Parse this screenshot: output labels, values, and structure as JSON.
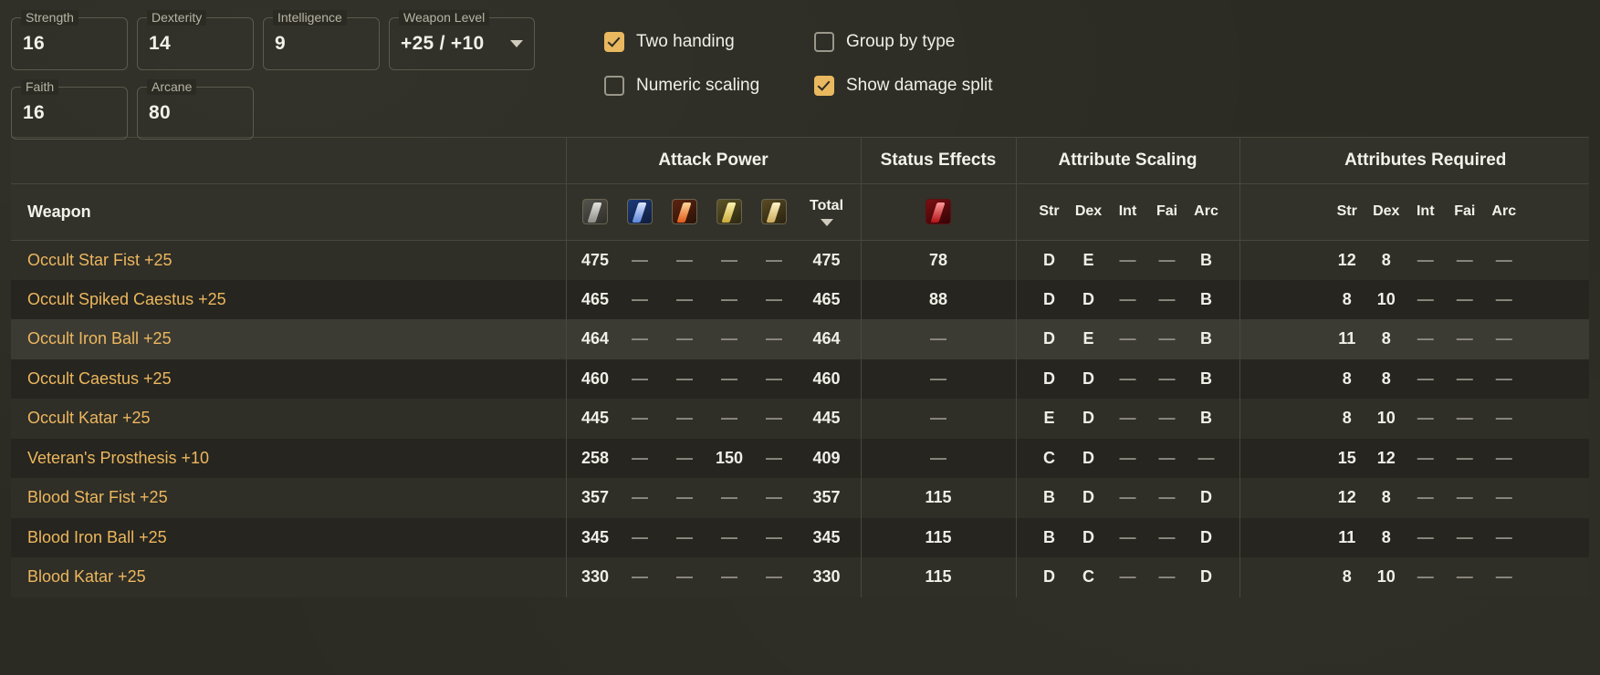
{
  "stats": {
    "fields": [
      {
        "label": "Strength",
        "value": "16",
        "type": "number"
      },
      {
        "label": "Dexterity",
        "value": "14",
        "type": "number"
      },
      {
        "label": "Intelligence",
        "value": "9",
        "type": "number"
      },
      {
        "label": "Weapon Level",
        "value": "+25 / +10",
        "type": "select"
      },
      {
        "label": "Faith",
        "value": "16",
        "type": "number"
      },
      {
        "label": "Arcane",
        "value": "80",
        "type": "number"
      }
    ]
  },
  "options": [
    {
      "label": "Two handing",
      "checked": true
    },
    {
      "label": "Group by type",
      "checked": false
    },
    {
      "label": "Numeric scaling",
      "checked": false
    },
    {
      "label": "Show damage split",
      "checked": true
    }
  ],
  "table": {
    "groups": [
      {
        "label": "",
        "name": "weapon"
      },
      {
        "label": "Attack Power",
        "name": "attack-power"
      },
      {
        "label": "Status Effects",
        "name": "status-effects"
      },
      {
        "label": "Attribute Scaling",
        "name": "attribute-scaling"
      },
      {
        "label": "Attributes Required",
        "name": "attributes-required"
      }
    ],
    "name_header": "Weapon",
    "total_header": "Total",
    "sort": {
      "column": "Total",
      "direction": "desc",
      "glyph": "▼"
    },
    "damage_icons": [
      {
        "name": "physical-damage-icon",
        "cls": "ico-phys"
      },
      {
        "name": "magic-damage-icon",
        "cls": "ico-mag"
      },
      {
        "name": "fire-damage-icon",
        "cls": "ico-fire"
      },
      {
        "name": "lightning-damage-icon",
        "cls": "ico-lit"
      },
      {
        "name": "holy-damage-icon",
        "cls": "ico-holy"
      }
    ],
    "status_icon": {
      "name": "bleed-status-icon",
      "cls": "ico-bleed"
    },
    "attribute_headers": [
      "Str",
      "Dex",
      "Int",
      "Fai",
      "Arc"
    ],
    "rows": [
      {
        "name": "Occult Star Fist +25",
        "damage": [
          "475",
          "—",
          "—",
          "—",
          "—"
        ],
        "total": "475",
        "status": [
          "78"
        ],
        "scaling": [
          "D",
          "E",
          "—",
          "—",
          "B"
        ],
        "required": [
          "12",
          "8",
          "—",
          "—",
          "—"
        ],
        "highlight": false
      },
      {
        "name": "Occult Spiked Caestus +25",
        "damage": [
          "465",
          "—",
          "—",
          "—",
          "—"
        ],
        "total": "465",
        "status": [
          "88"
        ],
        "scaling": [
          "D",
          "D",
          "—",
          "—",
          "B"
        ],
        "required": [
          "8",
          "10",
          "—",
          "—",
          "—"
        ],
        "highlight": false
      },
      {
        "name": "Occult Iron Ball +25",
        "damage": [
          "464",
          "—",
          "—",
          "—",
          "—"
        ],
        "total": "464",
        "status": [
          "—"
        ],
        "scaling": [
          "D",
          "E",
          "—",
          "—",
          "B"
        ],
        "required": [
          "11",
          "8",
          "—",
          "—",
          "—"
        ],
        "highlight": true
      },
      {
        "name": "Occult Caestus +25",
        "damage": [
          "460",
          "—",
          "—",
          "—",
          "—"
        ],
        "total": "460",
        "status": [
          "—"
        ],
        "scaling": [
          "D",
          "D",
          "—",
          "—",
          "B"
        ],
        "required": [
          "8",
          "8",
          "—",
          "—",
          "—"
        ],
        "highlight": false
      },
      {
        "name": "Occult Katar +25",
        "damage": [
          "445",
          "—",
          "—",
          "—",
          "—"
        ],
        "total": "445",
        "status": [
          "—"
        ],
        "scaling": [
          "E",
          "D",
          "—",
          "—",
          "B"
        ],
        "required": [
          "8",
          "10",
          "—",
          "—",
          "—"
        ],
        "highlight": false
      },
      {
        "name": "Veteran's Prosthesis +10",
        "damage": [
          "258",
          "—",
          "—",
          "150",
          "—"
        ],
        "total": "409",
        "status": [
          "—"
        ],
        "scaling": [
          "C",
          "D",
          "—",
          "—",
          "—"
        ],
        "required": [
          "15",
          "12",
          "—",
          "—",
          "—"
        ],
        "highlight": false
      },
      {
        "name": "Blood Star Fist +25",
        "damage": [
          "357",
          "—",
          "—",
          "—",
          "—"
        ],
        "total": "357",
        "status": [
          "115"
        ],
        "scaling": [
          "B",
          "D",
          "—",
          "—",
          "D"
        ],
        "required": [
          "12",
          "8",
          "—",
          "—",
          "—"
        ],
        "highlight": false
      },
      {
        "name": "Blood Iron Ball +25",
        "damage": [
          "345",
          "—",
          "—",
          "—",
          "—"
        ],
        "total": "345",
        "status": [
          "115"
        ],
        "scaling": [
          "B",
          "D",
          "—",
          "—",
          "D"
        ],
        "required": [
          "11",
          "8",
          "—",
          "—",
          "—"
        ],
        "highlight": false
      },
      {
        "name": "Blood Katar +25",
        "damage": [
          "330",
          "—",
          "—",
          "—",
          "—"
        ],
        "total": "330",
        "status": [
          "115"
        ],
        "scaling": [
          "D",
          "C",
          "—",
          "—",
          "D"
        ],
        "required": [
          "8",
          "10",
          "—",
          "—",
          "—"
        ],
        "highlight": false
      }
    ]
  },
  "colors": {
    "background": "#2b2b24",
    "accent": "#e9b85f",
    "weapon_name": "#edb75e",
    "text": "#f1efe8",
    "border": "#4a483d"
  }
}
